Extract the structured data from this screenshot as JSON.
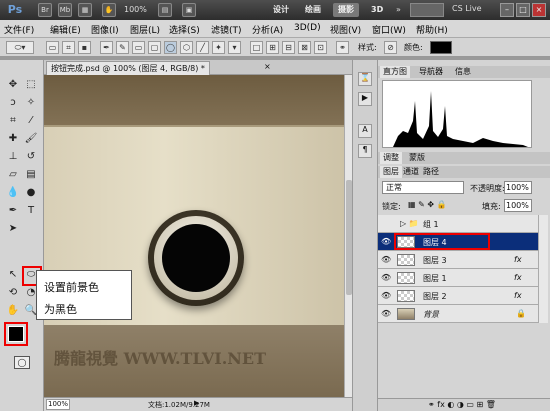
{
  "app": {
    "logo": "Ps",
    "icons": [
      "Br",
      "Mb"
    ],
    "zoom": "100%",
    "workspaces": [
      "设计",
      "绘画",
      "摄影",
      "3D"
    ],
    "cs_live": "CS Live"
  },
  "menu": [
    "文件(F)",
    "编辑(E)",
    "图像(I)",
    "图层(L)",
    "选择(S)",
    "滤镜(T)",
    "分析(A)",
    "3D(D)",
    "视图(V)",
    "窗口(W)",
    "帮助(H)"
  ],
  "options": {
    "style_label": "样式:",
    "color_label": "颜色:",
    "color": "#000000"
  },
  "document": {
    "tab_title": "按钮完成.psd @ 100% (图层 4, RGB/8) *",
    "zoom": "100%",
    "doc_info": "文档:1.02M/9.27M",
    "watermark": "腾龍視覺 WWW.TLVI.NET"
  },
  "callout": {
    "line1": "设置前景色",
    "line2": "为黑色"
  },
  "foreground_color": "#000000",
  "panels": {
    "top_tabs": [
      "直方图",
      "导航器",
      "信息"
    ],
    "mid_tabs": [
      "调整",
      "蒙版"
    ],
    "layer_tabs": [
      "图层",
      "通道",
      "路径"
    ],
    "blend_mode": "正常",
    "opacity_label": "不透明度:",
    "opacity": "100%",
    "lock_label": "锁定:",
    "fill_label": "填充:",
    "fill": "100%",
    "layers": [
      {
        "name": "组 1",
        "group": true
      },
      {
        "name": "图层 4",
        "selected": true
      },
      {
        "name": "图层 3",
        "fx": "fx"
      },
      {
        "name": "图层 1",
        "fx": "fx"
      },
      {
        "name": "图层 2",
        "fx": "fx"
      },
      {
        "name": "背景",
        "locked": true
      }
    ]
  }
}
